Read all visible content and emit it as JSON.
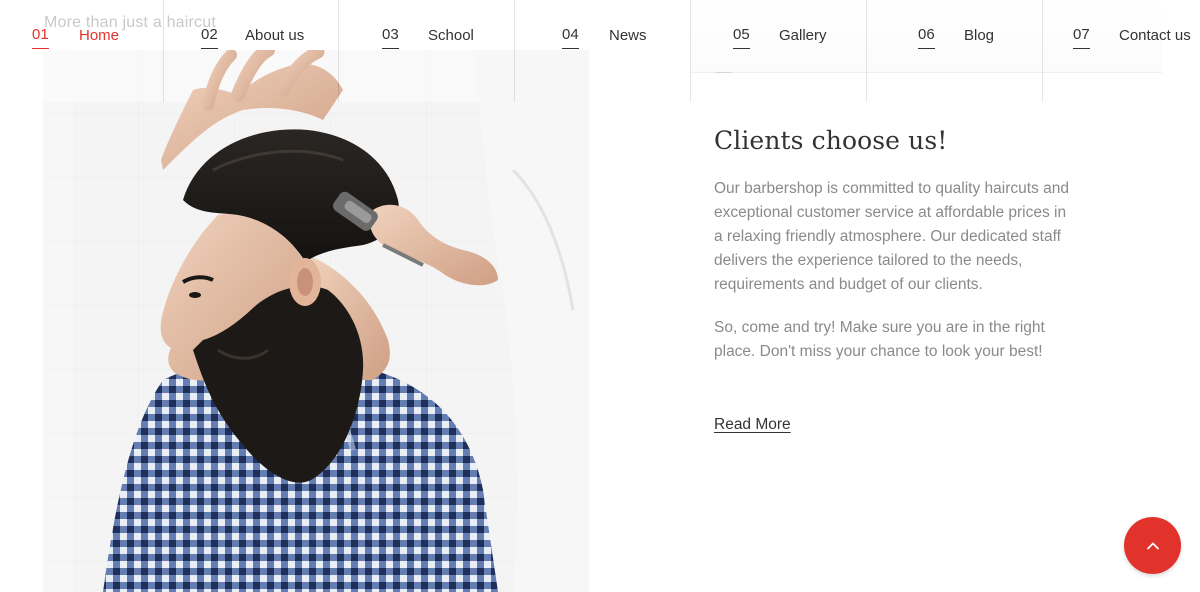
{
  "background_tagline": "More than just a haircut",
  "nav": {
    "items": [
      {
        "num": "01",
        "label": "Home",
        "active": true
      },
      {
        "num": "02",
        "label": "About us"
      },
      {
        "num": "03",
        "label": "School"
      },
      {
        "num": "04",
        "label": "News"
      },
      {
        "num": "05",
        "label": "Gallery"
      },
      {
        "num": "06",
        "label": "Blog"
      },
      {
        "num": "07",
        "label": "Contact us"
      }
    ]
  },
  "section": {
    "title": "Clients choose us!",
    "paragraph1": "Our barbershop is committed to quality haircuts and exceptional customer service at affordable prices in a relaxing friendly atmosphere. Our dedicated staff delivers the experience tailored to the needs, requirements and budget of our clients.",
    "paragraph2": "So, come and try! Make sure you are in the right place. Don't miss your chance to look your best!",
    "read_more": "Read More"
  },
  "colors": {
    "accent": "#e2322c",
    "text": "#333333",
    "muted": "#8a8a8a"
  },
  "icons": {
    "scroll_top": "chevron-up-icon"
  }
}
